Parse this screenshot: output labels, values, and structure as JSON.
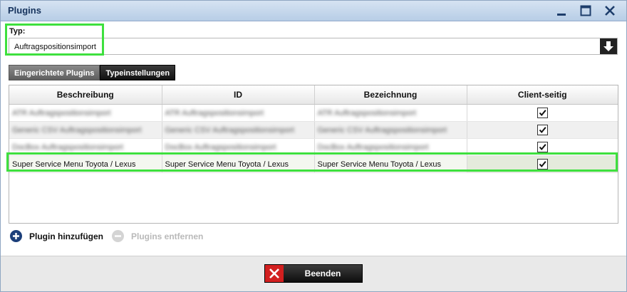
{
  "window": {
    "title": "Plugins"
  },
  "typ": {
    "label": "Typ:",
    "value": "Auftragspositionsimport"
  },
  "tabs": [
    {
      "label": "Eingerichtete Plugins",
      "active": true
    },
    {
      "label": "Typeinstellungen",
      "active": false
    }
  ],
  "table": {
    "columns": [
      "Beschreibung",
      "ID",
      "Bezeichnung",
      "Client-seitig"
    ],
    "rows": [
      {
        "cells": [
          "ATR Auftragspositionsimport",
          "ATR Auftragspositionsimport",
          "ATR Auftragspositionsimport"
        ],
        "client_side": true,
        "blurred": true
      },
      {
        "cells": [
          "Generic CSV Auftragspositionsimport",
          "Generic CSV Auftragspositionsimport",
          "Generic CSV Auftragspositionsimport"
        ],
        "client_side": true,
        "blurred": true
      },
      {
        "cells": [
          "DocBox Auftragspositionsimport",
          "DocBox Auftragspositionsimport",
          "DocBox Auftragspositionsimport"
        ],
        "client_side": true,
        "blurred": true
      },
      {
        "cells": [
          "Super Service Menu Toyota / Lexus",
          "Super Service Menu Toyota / Lexus",
          "Super Service Menu Toyota / Lexus"
        ],
        "client_side": true,
        "blurred": false,
        "selected": true
      }
    ]
  },
  "actions": {
    "add_label": "Plugin hinzufügen",
    "remove_label": "Plugins entfernen"
  },
  "footer": {
    "end_label": "Beenden"
  },
  "colors": {
    "highlight": "#3ee03e",
    "add_icon": "#1c3f7a",
    "close_icon": "#d21f1f"
  }
}
